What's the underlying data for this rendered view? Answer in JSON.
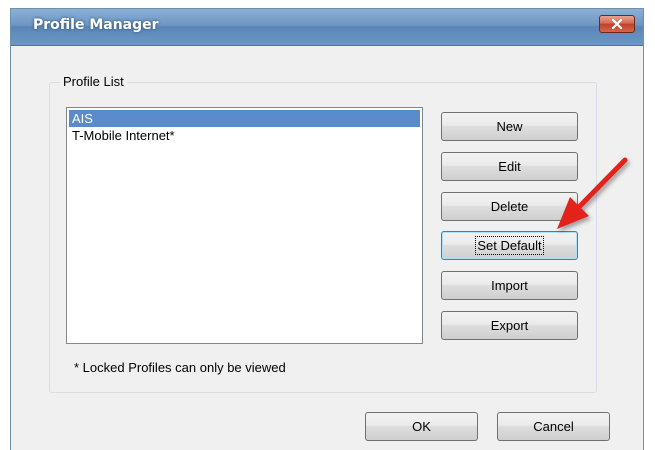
{
  "window": {
    "title": "Profile Manager",
    "close_icon": "close-icon"
  },
  "group": {
    "label": "Profile List"
  },
  "profiles": [
    {
      "name": "AIS",
      "selected": true
    },
    {
      "name": "T-Mobile Internet*",
      "selected": false
    }
  ],
  "footnote": "* Locked Profiles can only be viewed",
  "buttons": {
    "new": "New",
    "edit": "Edit",
    "delete": "Delete",
    "set_default": "Set Default",
    "import": "Import",
    "export": "Export",
    "ok": "OK",
    "cancel": "Cancel"
  },
  "colors": {
    "selection": "#5a8ccc",
    "annotation_arrow": "#e3241b",
    "close_button": "#c0412a"
  }
}
